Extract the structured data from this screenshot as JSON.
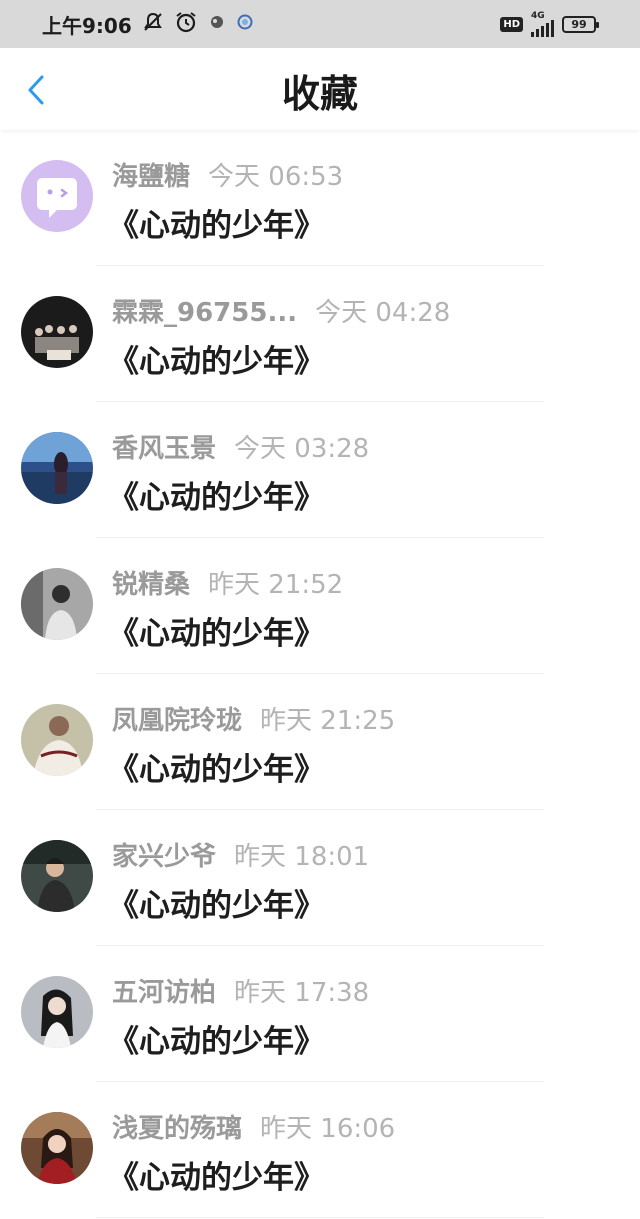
{
  "status_bar": {
    "time": "上午9:06",
    "hd": "HD",
    "network": "4G",
    "battery": "99"
  },
  "header": {
    "title": "收藏"
  },
  "items": [
    {
      "username": "海鹽糖",
      "time": "今天 06:53",
      "title": "《心动的少年》"
    },
    {
      "username": "霖霖_96755...",
      "time": "今天 04:28",
      "title": "《心动的少年》"
    },
    {
      "username": "香风玉景",
      "time": "今天 03:28",
      "title": "《心动的少年》"
    },
    {
      "username": "锐精桑",
      "time": "昨天 21:52",
      "title": "《心动的少年》"
    },
    {
      "username": "凤凰院玲珑",
      "time": "昨天 21:25",
      "title": "《心动的少年》"
    },
    {
      "username": "家兴少爷",
      "time": "昨天 18:01",
      "title": "《心动的少年》"
    },
    {
      "username": "五河访柏",
      "time": "昨天 17:38",
      "title": "《心动的少年》"
    },
    {
      "username": "浅夏的殇璃",
      "time": "昨天 16:06",
      "title": "《心动的少年》"
    }
  ],
  "colors": {
    "accent": "#2e9bea",
    "status_bar_bg": "#d9d9d9",
    "username": "#9a9a9a",
    "timestamp": "#b4b4b4",
    "title": "#1e1e1e"
  }
}
